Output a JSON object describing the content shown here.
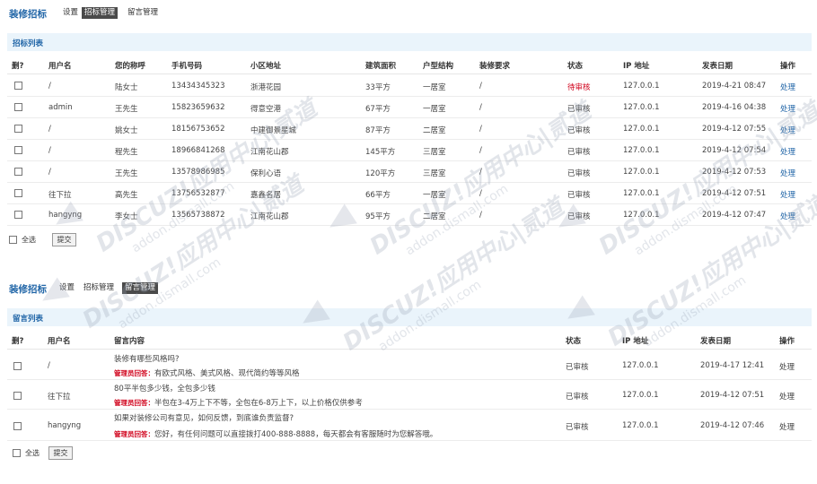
{
  "bid_section": {
    "brand": "装修招标",
    "nav": [
      "设置",
      "招标管理",
      "留言管理"
    ],
    "active_nav": 1,
    "list_title": "招标列表",
    "headers": [
      "删?",
      "用户名",
      "您的称呼",
      "手机号码",
      "小区地址",
      "建筑面积",
      "户型结构",
      "装修要求",
      "状态",
      "IP 地址",
      "发表日期",
      "操作"
    ],
    "rows": [
      {
        "user": "/",
        "name": "陆女士",
        "phone": "13434345323",
        "address": "浙港花园",
        "area": "33平方",
        "layout": "一居室",
        "req": "/",
        "status": "待审核",
        "pending": true,
        "ip": "127.0.0.1",
        "date": "2019-4-21 08:47",
        "op": "处理"
      },
      {
        "user": "admin",
        "name": "王先生",
        "phone": "15823659632",
        "address": "得意空港",
        "area": "67平方",
        "layout": "一居室",
        "req": "/",
        "status": "已审核",
        "pending": false,
        "ip": "127.0.0.1",
        "date": "2019-4-16 04:38",
        "op": "处理"
      },
      {
        "user": "/",
        "name": "姚女士",
        "phone": "18156753652",
        "address": "中建御景星城",
        "area": "87平方",
        "layout": "二居室",
        "req": "/",
        "status": "已审核",
        "pending": false,
        "ip": "127.0.0.1",
        "date": "2019-4-12 07:55",
        "op": "处理"
      },
      {
        "user": "/",
        "name": "程先生",
        "phone": "18966841268",
        "address": "江南花山郡",
        "area": "145平方",
        "layout": "三居室",
        "req": "/",
        "status": "已审核",
        "pending": false,
        "ip": "127.0.0.1",
        "date": "2019-4-12 07:54",
        "op": "处理"
      },
      {
        "user": "/",
        "name": "王先生",
        "phone": "13578986985",
        "address": "保利心语",
        "area": "120平方",
        "layout": "三居室",
        "req": "/",
        "status": "已审核",
        "pending": false,
        "ip": "127.0.0.1",
        "date": "2019-4-12 07:53",
        "op": "处理"
      },
      {
        "user": "往下拉",
        "name": "高先生",
        "phone": "13756532877",
        "address": "嘉鑫名居",
        "area": "66平方",
        "layout": "一居室",
        "req": "/",
        "status": "已审核",
        "pending": false,
        "ip": "127.0.0.1",
        "date": "2019-4-12 07:51",
        "op": "处理"
      },
      {
        "user": "hangyng",
        "name": "李女士",
        "phone": "13565738872",
        "address": "江南花山郡",
        "area": "95平方",
        "layout": "二居室",
        "req": "/",
        "status": "已审核",
        "pending": false,
        "ip": "127.0.0.1",
        "date": "2019-4-12 07:47",
        "op": "处理"
      }
    ],
    "select_all": "全选",
    "submit": "提交"
  },
  "msg_section": {
    "brand": "装修招标",
    "nav": [
      "设置",
      "招标管理",
      "留言管理"
    ],
    "active_nav": 2,
    "list_title": "留言列表",
    "headers": [
      "删?",
      "用户名",
      "留言内容",
      "状态",
      "IP 地址",
      "发表日期",
      "操作"
    ],
    "rows": [
      {
        "user": "/",
        "content": "装修有哪些风格吗?",
        "admin_label": "管理员回答：",
        "reply": "有欧式风格、美式风格、现代简约等等风格",
        "status": "已审核",
        "ip": "127.0.0.1",
        "date": "2019-4-17 12:41",
        "op": "处理"
      },
      {
        "user": "往下拉",
        "content": "80平半包多少钱，全包多少钱",
        "admin_label": "管理员回答：",
        "reply": "半包在3-4万上下不等，全包在6-8万上下，以上价格仅供参考",
        "status": "已审核",
        "ip": "127.0.0.1",
        "date": "2019-4-12 07:51",
        "op": "处理"
      },
      {
        "user": "hangyng",
        "content": "如果对装修公司有意见，如何反馈，到底谁负责监督?",
        "admin_label": "管理员回答：",
        "reply": "您好，有任何问题可以直接拨打400-888-8888，每天都会有客服随时为您解答哦。",
        "status": "已审核",
        "ip": "127.0.0.1",
        "date": "2019-4-12 07:46",
        "op": "处理"
      }
    ],
    "select_all": "全选",
    "submit": "提交"
  },
  "watermark": {
    "text": "DISCUZ!应用中心|贰道",
    "url": "addon.dismall.com"
  },
  "colors": {
    "brand": "#2367a8",
    "pending": "#d0021b",
    "listbar": "#eaf4fb"
  }
}
